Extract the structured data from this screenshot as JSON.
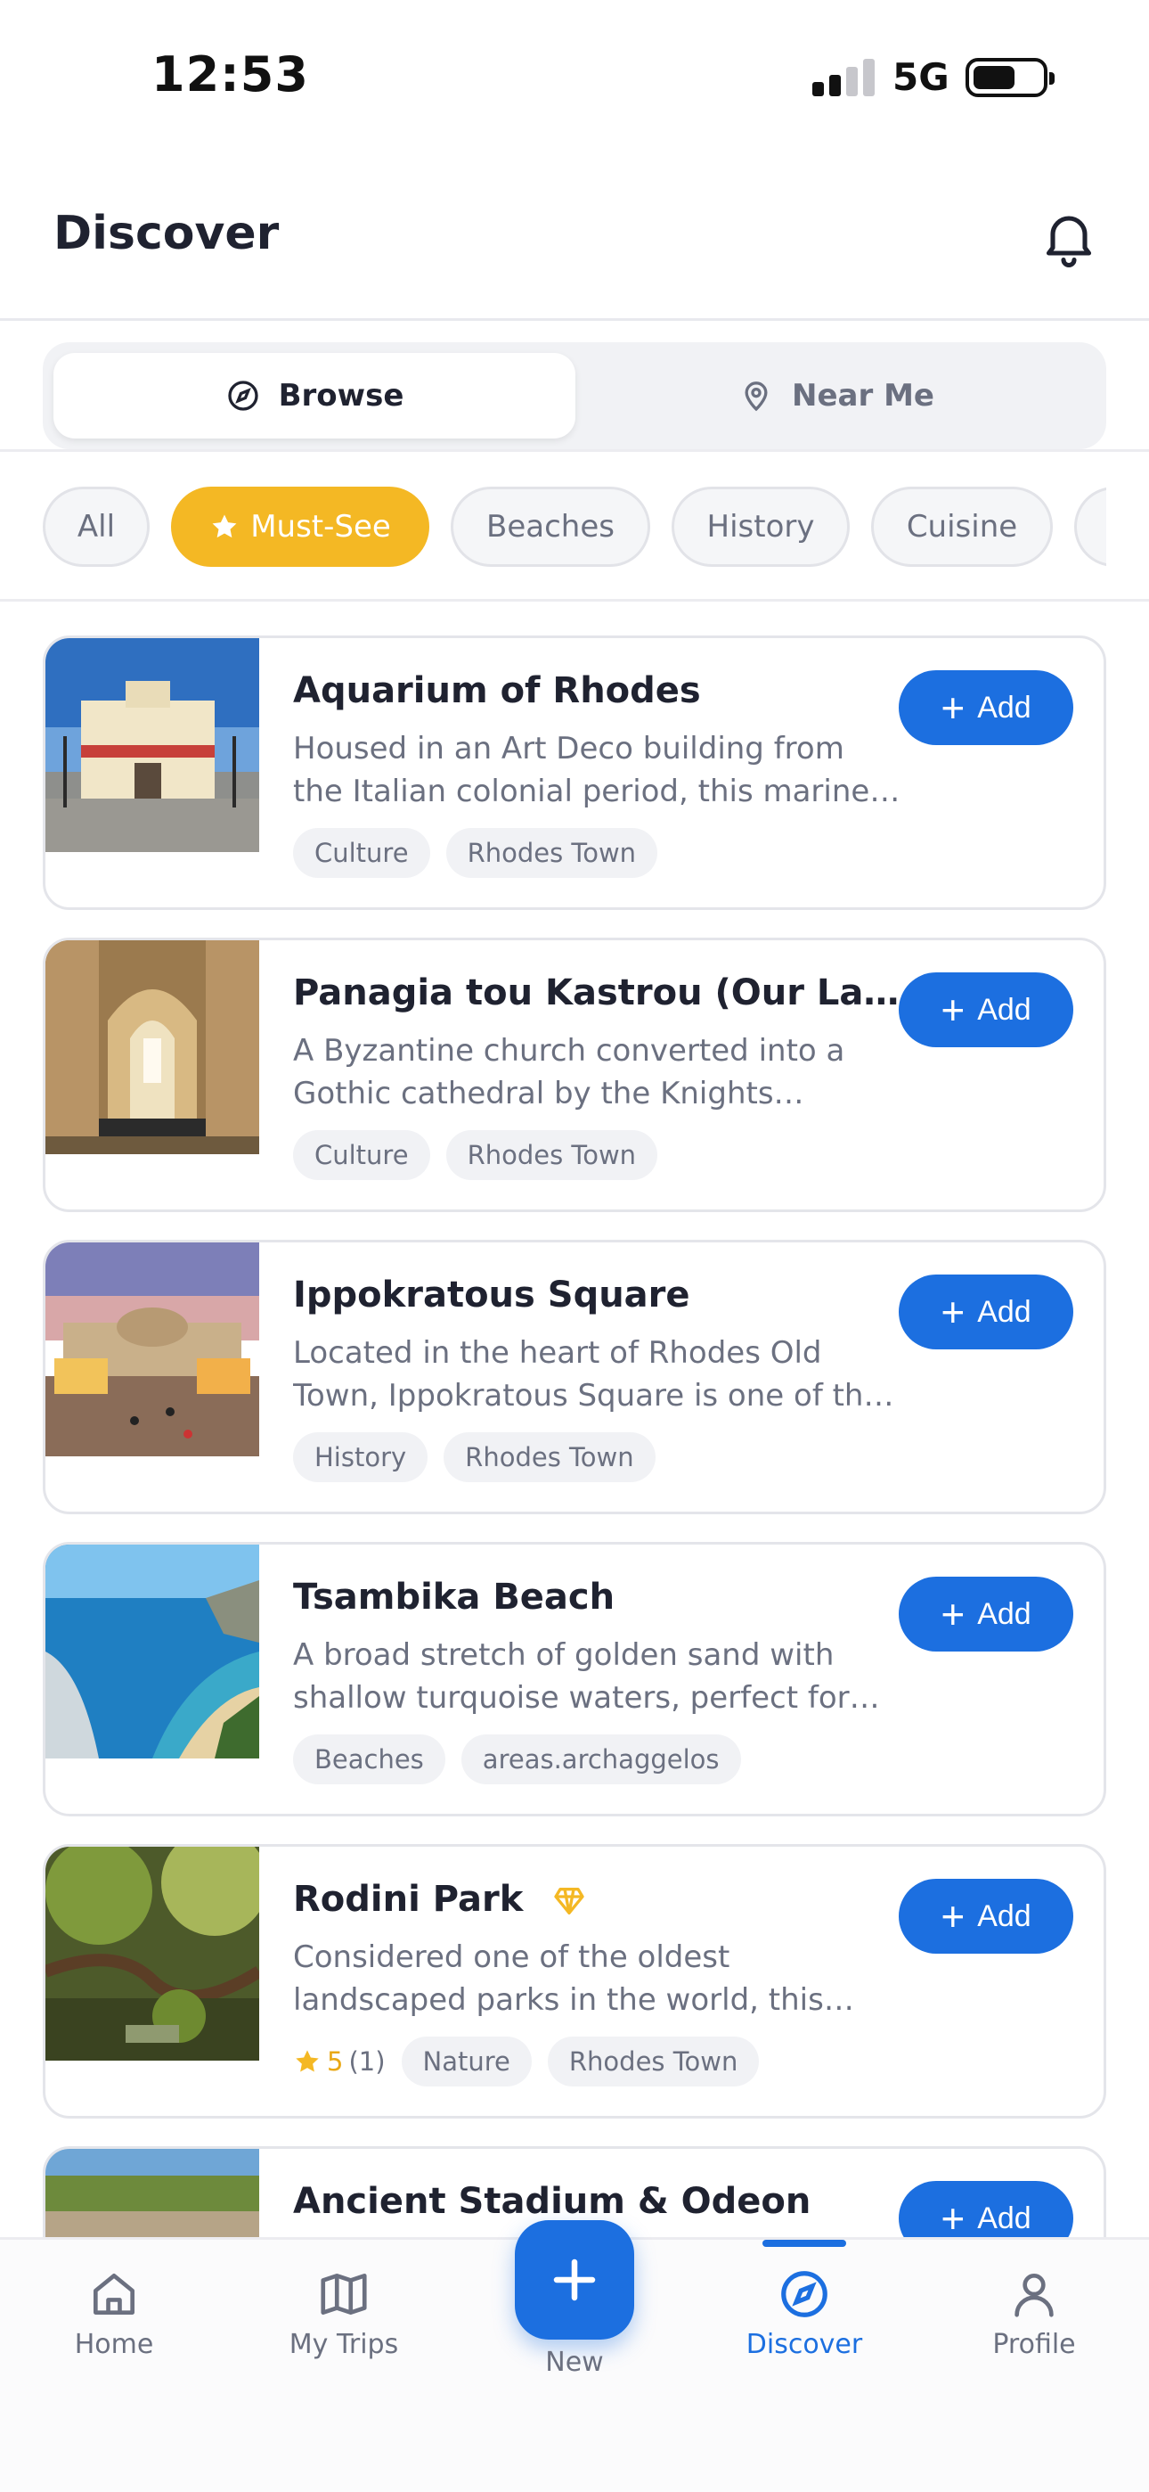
{
  "status_bar": {
    "time": "12:53",
    "network": "5G"
  },
  "header": {
    "title": "Discover"
  },
  "segments": [
    {
      "label": "Browse",
      "icon": "compass-icon",
      "active": true
    },
    {
      "label": "Near Me",
      "icon": "map-pin-icon",
      "active": false
    }
  ],
  "filters": [
    {
      "label": "All",
      "active": false
    },
    {
      "label": "Must-See",
      "active": true,
      "icon": "star-icon"
    },
    {
      "label": "Beaches",
      "active": false
    },
    {
      "label": "History",
      "active": false
    },
    {
      "label": "Cuisine",
      "active": false
    }
  ],
  "add_label": "Add",
  "places": [
    {
      "title": "Aquarium of Rhodes",
      "desc1": "Housed in an Art Deco building from",
      "desc2": "the Italian colonial period, this marine…",
      "tags": [
        "Culture",
        "Rhodes Town"
      ]
    },
    {
      "title": "Panagia tou Kastrou (Our Lady …",
      "desc1": "A Byzantine church converted into a",
      "desc2": "Gothic cathedral by the Knights…",
      "tags": [
        "Culture",
        "Rhodes Town"
      ]
    },
    {
      "title": "Ippokratous Square",
      "desc1": "Located in the heart of Rhodes Old",
      "desc2": "Town, Ippokratous Square is one of th…",
      "tags": [
        "History",
        "Rhodes Town"
      ]
    },
    {
      "title": "Tsambika Beach",
      "desc1": "A broad stretch of golden sand with",
      "desc2": "shallow turquoise waters, perfect for…",
      "tags": [
        "Beaches",
        "areas.archaggelos"
      ]
    },
    {
      "title": "Rodini Park",
      "premium_icon": "gem-icon",
      "desc1": "Considered one of the oldest",
      "desc2": "landscaped parks in the world, this…",
      "rating": "5",
      "rating_count": "(1)",
      "tags": [
        "Nature",
        "Rhodes Town"
      ]
    },
    {
      "title": "Ancient Stadium & Odeon"
    }
  ],
  "tabbar": {
    "home": "Home",
    "trips": "My Trips",
    "new": "New",
    "discover": "Discover",
    "profile": "Profile"
  },
  "colors": {
    "accent": "#1c6fe0",
    "must_see": "#f4b824",
    "text": "#1f2230",
    "muted": "#6b7080"
  }
}
